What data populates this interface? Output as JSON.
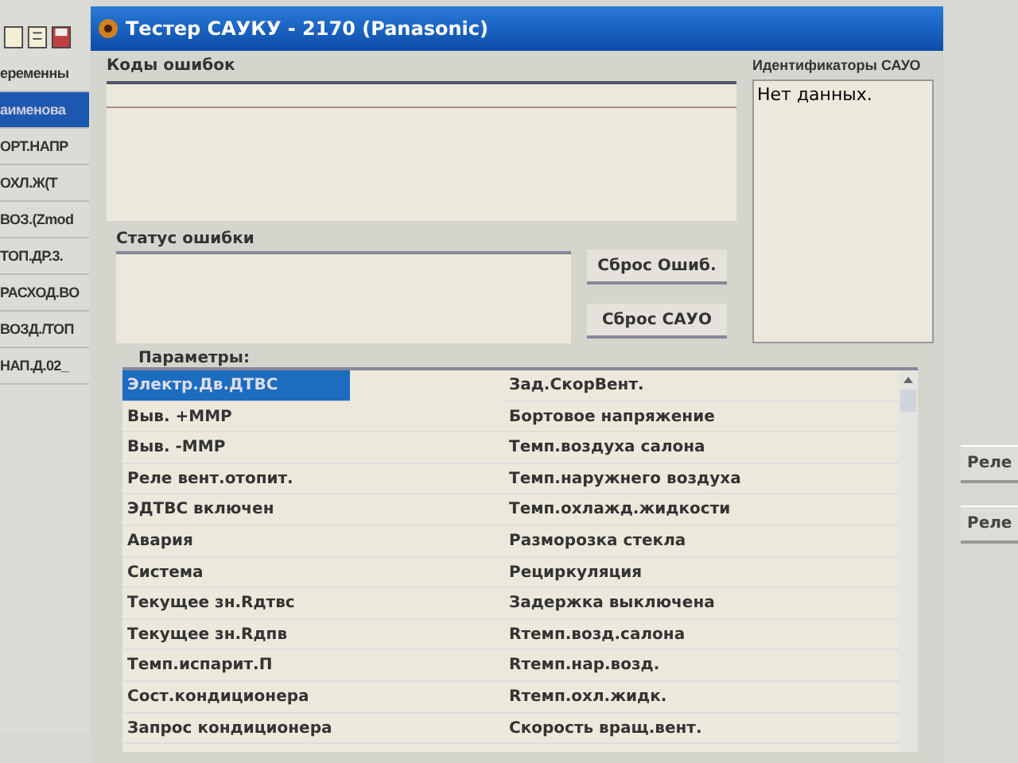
{
  "background_window": {
    "side_items": [
      {
        "label": "еременны",
        "selected": false
      },
      {
        "label": "аименова",
        "selected": true
      },
      {
        "label": "ОРТ.НАПР",
        "selected": false
      },
      {
        "label": "ОХЛ.Ж(Т",
        "selected": false
      },
      {
        "label": "ВОЗ.(Zmod",
        "selected": false
      },
      {
        "label": "ТОП.ДР.3.",
        "selected": false
      },
      {
        "label": "РАСХОД.ВО",
        "selected": false
      },
      {
        "label": "ВОЗД./ТОП",
        "selected": false
      },
      {
        "label": "НАП.Д.02_",
        "selected": false
      }
    ],
    "right_buttons": [
      "Реле",
      "Реле"
    ]
  },
  "window": {
    "title": "Тестер САУКУ - 2170 (Panasonic)"
  },
  "error_codes": {
    "label": "Коды ошибок"
  },
  "error_status": {
    "label": "Статус ошибки"
  },
  "buttons": [
    "Сброс Ошиб.",
    "Сброс САУО"
  ],
  "identifiers": {
    "label": "Идентификаторы САУО",
    "text": "Нет данных."
  },
  "parameters": {
    "label": "Параметры:",
    "rows": [
      {
        "left": "Электр.Дв.ДТВС",
        "right": "Зад.СкорВент.",
        "selected": true
      },
      {
        "left": "Выв. +ММР",
        "right": "Бортовое напряжение",
        "selected": false
      },
      {
        "left": "Выв. -ММР",
        "right": "Темп.воздуха салона",
        "selected": false
      },
      {
        "left": "Реле вент.отопит.",
        "right": "Темп.наружнего воздуха",
        "selected": false
      },
      {
        "left": "ЭДТВС включен",
        "right": "Темп.охлажд.жидкости",
        "selected": false
      },
      {
        "left": "Авария",
        "right": "Разморозка стекла",
        "selected": false
      },
      {
        "left": "Система",
        "right": "Рециркуляция",
        "selected": false
      },
      {
        "left": "Текущее зн.Rдтвс",
        "right": "Задержка выключена",
        "selected": false
      },
      {
        "left": "Текущее зн.Rдпв",
        "right": "Rтемп.возд.салона",
        "selected": false
      },
      {
        "left": "Темп.испарит.П",
        "right": "Rтемп.нар.возд.",
        "selected": false
      },
      {
        "left": "Сост.кондиционера",
        "right": "Rтемп.охл.жидк.",
        "selected": false
      },
      {
        "left": "Запрос кондиционера",
        "right": "Скорость вращ.вент.",
        "selected": false
      }
    ]
  }
}
